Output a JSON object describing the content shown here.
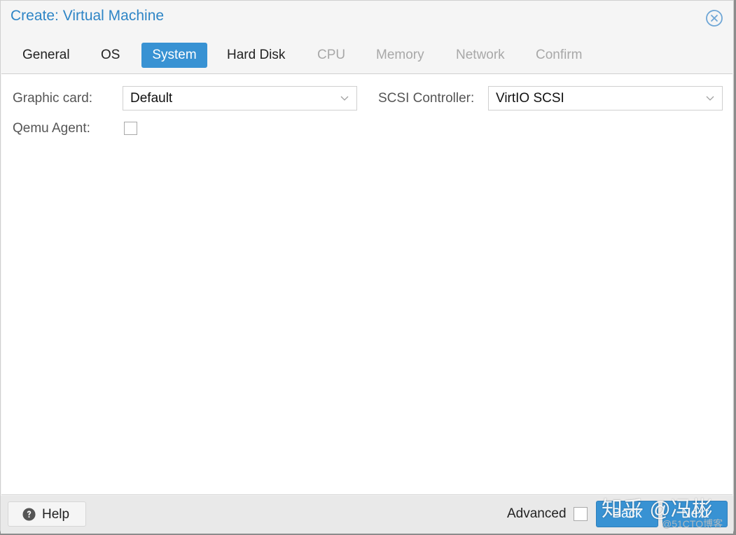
{
  "window": {
    "title": "Create: Virtual Machine",
    "close_icon": "close-circle-icon"
  },
  "tabs": [
    {
      "label": "General",
      "state": "normal"
    },
    {
      "label": "OS",
      "state": "normal"
    },
    {
      "label": "System",
      "state": "active"
    },
    {
      "label": "Hard Disk",
      "state": "normal"
    },
    {
      "label": "CPU",
      "state": "disabled"
    },
    {
      "label": "Memory",
      "state": "disabled"
    },
    {
      "label": "Network",
      "state": "disabled"
    },
    {
      "label": "Confirm",
      "state": "disabled"
    }
  ],
  "form": {
    "graphic_card": {
      "label": "Graphic card:",
      "value": "Default"
    },
    "scsi_controller": {
      "label": "SCSI Controller:",
      "value": "VirtIO SCSI"
    },
    "qemu_agent": {
      "label": "Qemu Agent:",
      "checked": false
    }
  },
  "footer": {
    "help_label": "Help",
    "help_icon": "question-circle-icon",
    "advanced_label": "Advanced",
    "advanced_checked": false,
    "back_label": "Back",
    "next_label": "Next"
  },
  "watermark": {
    "main": "知乎 @冯彬",
    "sub": "@51CTO博客"
  },
  "colors": {
    "accent": "#3892d3",
    "title": "#2e85c6",
    "disabled_tab": "#a8a8a8"
  }
}
